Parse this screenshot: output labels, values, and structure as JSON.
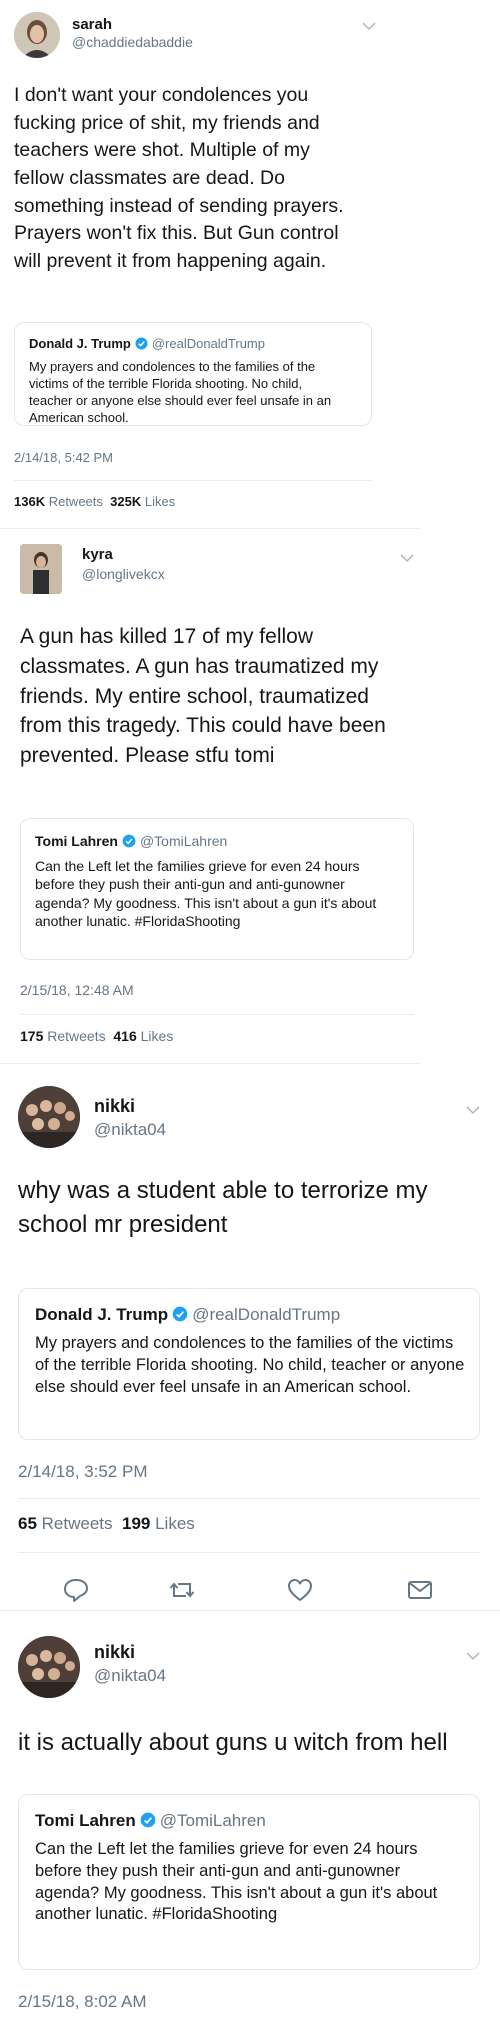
{
  "tweets": [
    {
      "name": "sarah",
      "handle": "@chaddiedabaddie",
      "text": "I don't want your condolences you fucking price of shit, my friends and teachers were shot. Multiple of my fellow classmates are dead. Do something instead of sending prayers. Prayers won't fix this. But Gun control will prevent it from happening again.",
      "quote": {
        "name": "Donald J. Trump",
        "handle": "@realDonaldTrump",
        "text": "My prayers and condolences to the families of the victims of the terrible Florida shooting. No child, teacher or anyone else should ever feel unsafe in an American school."
      },
      "date": "2/14/18, 5:42 PM",
      "retweets": "136K",
      "retweets_label": "Retweets",
      "likes": "325K",
      "likes_label": "Likes"
    },
    {
      "name": "kyra",
      "handle": "@longlivekcx",
      "text": "A gun has killed 17 of my fellow classmates. A gun has traumatized my friends. My entire school, traumatized from this tragedy. This could have been prevented. Please stfu tomi",
      "quote": {
        "name": "Tomi Lahren",
        "handle": "@TomiLahren",
        "text": "Can the Left let the families grieve for even 24 hours before they push their anti-gun and anti-gunowner agenda? My goodness. This isn't about a gun it's about another lunatic. #FloridaShooting"
      },
      "date": "2/15/18, 12:48 AM",
      "retweets": "175",
      "retweets_label": "Retweets",
      "likes": "416",
      "likes_label": "Likes"
    },
    {
      "name": "nikki",
      "handle": "@nikta04",
      "text": "why was a student able to terrorize my school mr president",
      "quote": {
        "name": "Donald J. Trump",
        "handle": "@realDonaldTrump",
        "text": "My prayers and condolences to the families of the victims of the terrible Florida shooting. No child, teacher or anyone else should ever feel unsafe in an American school."
      },
      "date": "2/14/18, 3:52 PM",
      "retweets": "65",
      "retweets_label": "Retweets",
      "likes": "199",
      "likes_label": "Likes"
    },
    {
      "name": "nikki",
      "handle": "@nikta04",
      "text": "it is actually about guns u witch from hell",
      "quote": {
        "name": "Tomi Lahren",
        "handle": "@TomiLahren",
        "text": "Can the Left let the families grieve for even 24 hours before they push their anti-gun and anti-gunowner agenda? My goodness. This isn't about a gun it's about another lunatic. #FloridaShooting"
      },
      "date": "2/15/18, 8:02 AM"
    }
  ],
  "icons": {
    "reply": "reply-icon",
    "retweet": "retweet-icon",
    "like": "heart-icon",
    "dm": "envelope-icon",
    "verified": "verified-badge-icon",
    "menu": "chevron-down-icon"
  },
  "colors": {
    "text": "#14171a",
    "secondary": "#657786",
    "verified": "#1da1f2",
    "border": "#e1e8ed"
  }
}
